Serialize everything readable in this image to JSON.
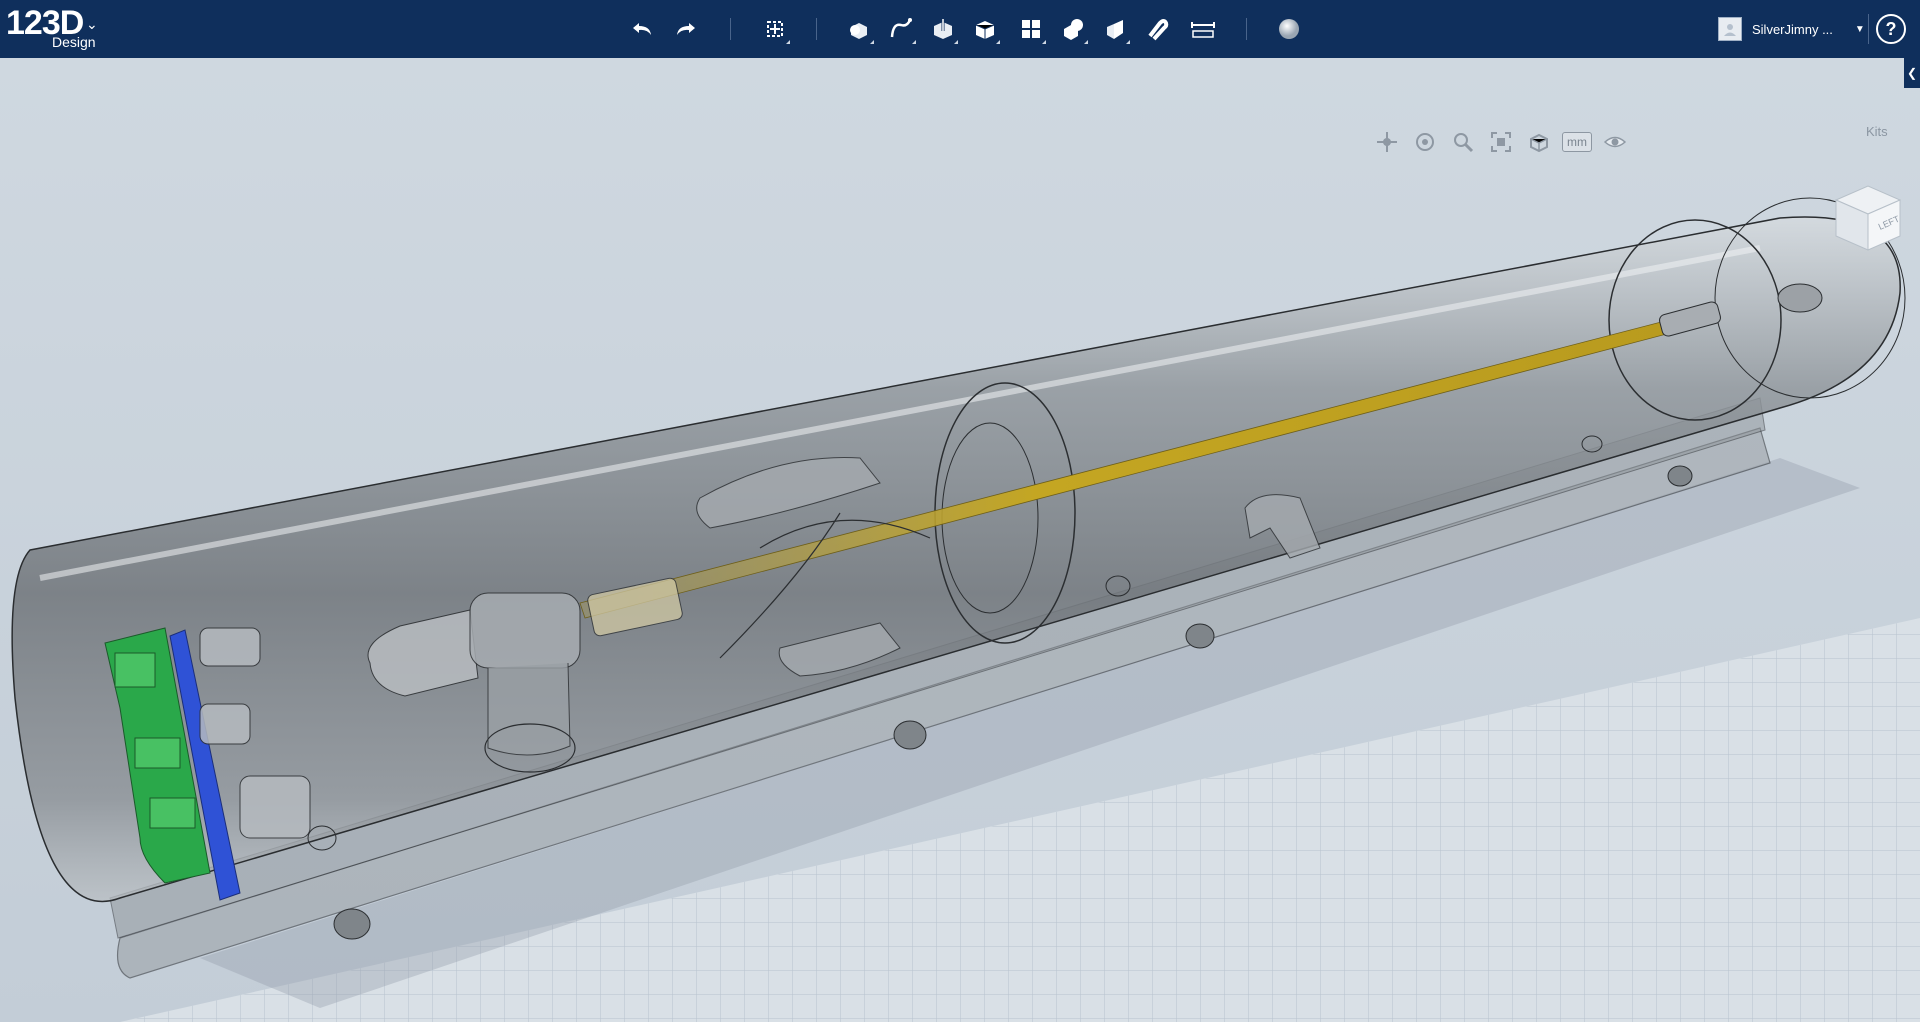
{
  "app": {
    "logo_number": "123D",
    "logo_sub": "Design",
    "logo_chevron": "⌄"
  },
  "toolbar": {
    "icons": [
      "undo-icon",
      "redo-icon",
      "transform-icon",
      "primitives-icon",
      "sketch-icon",
      "construct-icon",
      "modify-icon",
      "pattern-icon",
      "grouping-icon",
      "combine-icon",
      "snap-icon",
      "measure-icon",
      "material-icon"
    ]
  },
  "user": {
    "name": "SilverJimny ...",
    "dropdown": "▼"
  },
  "help": {
    "label": "?"
  },
  "viewport": {
    "unit": "mm",
    "kits_label": "Kits",
    "kits_tab": "❮",
    "viewcube_label": "LEFT",
    "background": "#c9d3dc",
    "grid_color": "#b6c2ce",
    "accent_green": "#2aa84a",
    "accent_blue": "#2f52d6",
    "rod_color": "#c9a81e"
  },
  "navtools": {
    "icons": [
      "pan-icon",
      "orbit-icon",
      "zoom-icon",
      "fit-icon",
      "view-icon",
      "unit-badge",
      "visibility-icon"
    ]
  }
}
